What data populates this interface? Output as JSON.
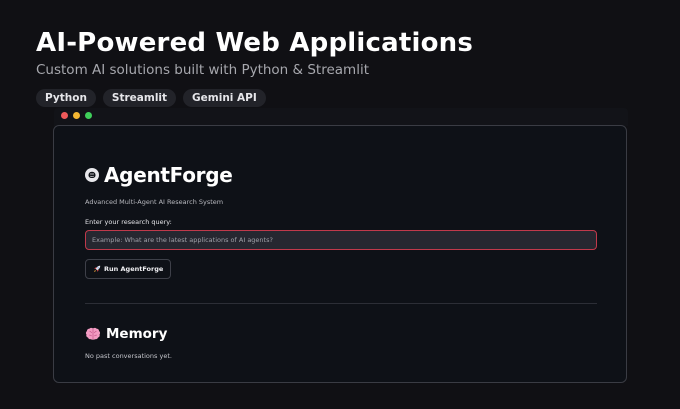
{
  "hero": {
    "title": "AI-Powered Web Applications",
    "subtitle": "Custom AI solutions built with Python & Streamlit",
    "tags": [
      "Python",
      "Streamlit",
      "Gemini API"
    ]
  },
  "app": {
    "brand_icon": "brain-icon",
    "brand_name": "AgentForge",
    "tagline": "Advanced Multi-Agent AI Research System",
    "query_label": "Enter your research query:",
    "query_placeholder": "Example: What are the latest applications of AI agents?",
    "query_value": "",
    "run_button_icon": "rocket-icon",
    "run_button_label": "Run AgentForge",
    "memory_icon": "brain-icon",
    "memory_title": "Memory",
    "memory_empty_text": "No past conversations yet."
  },
  "colors": {
    "background": "#101014",
    "window_background": "#0e1117",
    "input_border_focus": "#c0394b",
    "tag_background": "#222329",
    "window_dot_red": "#ef5a5a",
    "window_dot_yellow": "#f3b632",
    "window_dot_green": "#3fcf5a",
    "memory_icon": "#f29bc2"
  }
}
